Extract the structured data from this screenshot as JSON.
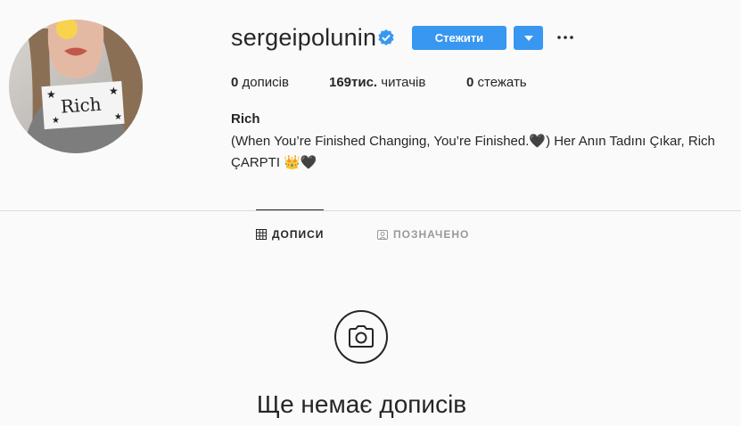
{
  "profile": {
    "username": "sergeipolunin",
    "verified_icon": "verified-badge-icon",
    "follow_label": "Стежити",
    "avatar_icon": "profile-photo",
    "avatar_text": "Rich"
  },
  "stats": {
    "posts_count": "0",
    "posts_label": "дописів",
    "followers_count": "169тис.",
    "followers_label": "читачів",
    "following_count": "0",
    "following_label": "стежать"
  },
  "bio": {
    "name": "Rich",
    "text": "(When You’re Finished Changing, You’re Finished.🖤) Her Anın Tadını Çıkar, Rich ÇARPTI 👑🖤"
  },
  "tabs": [
    {
      "label": "ДОПИСИ",
      "icon": "grid-icon",
      "active": true
    },
    {
      "label": "ПОЗНАЧЕНО",
      "icon": "tagged-icon",
      "active": false
    }
  ],
  "empty_state": {
    "icon": "camera-icon",
    "title": "Ще немає дописів"
  },
  "colors": {
    "accent": "#3897f0",
    "text": "#262626",
    "muted": "#999999",
    "background": "#fafafa"
  }
}
